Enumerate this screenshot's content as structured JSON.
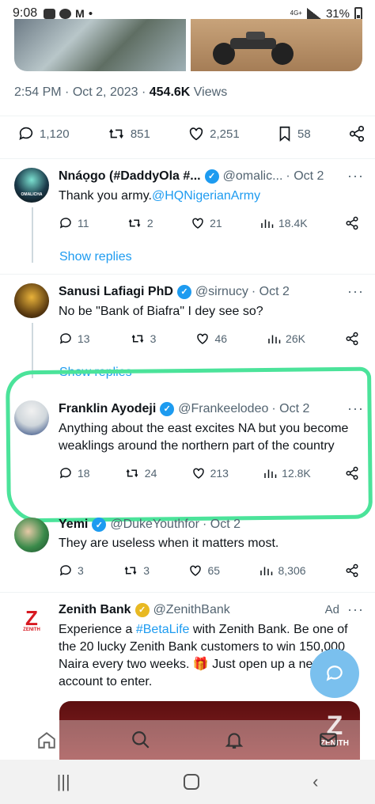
{
  "status_bar": {
    "time": "9:08",
    "network": "4G+",
    "battery": "31%"
  },
  "tweet_meta": {
    "time": "2:54 PM",
    "date": "Oct 2, 2023",
    "views_count": "454.6K",
    "views_label": "Views"
  },
  "tweet_stats": {
    "replies": "1,120",
    "reposts": "851",
    "likes": "2,251",
    "bookmarks": "58"
  },
  "show_replies_label": "Show replies",
  "replies": [
    {
      "name": "Nnáọgo (#DaddyOla #...",
      "handle": "@omalic...",
      "date": "Oct 2",
      "text_before": "Thank you army.",
      "mention": "@HQNigerianArmy",
      "text_after": "",
      "replies": "11",
      "reposts": "2",
      "likes": "21",
      "views": "18.4K",
      "avatar_label": "OMALICHA"
    },
    {
      "name": "Sanusi Lafiagi PhD",
      "handle": "@sirnucy",
      "date": "Oct 2",
      "text_before": "No be \"Bank of Biafra\" I dey see so?",
      "mention": "",
      "text_after": "",
      "replies": "13",
      "reposts": "3",
      "likes": "46",
      "views": "26K"
    },
    {
      "name": "Franklin Ayodeji",
      "handle": "@Frankeelodeo",
      "date": "Oct 2",
      "text_before": "Anything about the east excites NA but you become weaklings around the northern part of the country",
      "mention": "",
      "text_after": "",
      "replies": "18",
      "reposts": "24",
      "likes": "213",
      "views": "12.8K"
    },
    {
      "name": "Yemi",
      "handle": "@DukeYouthfor",
      "date": "Oct 2",
      "text_before": "They are useless when it matters most.",
      "mention": "",
      "text_after": "",
      "replies": "3",
      "reposts": "3",
      "likes": "65",
      "views": "8,306"
    }
  ],
  "ad": {
    "name": "Zenith Bank",
    "handle": "@ZenithBank",
    "label": "Ad",
    "text_before": "Experience a ",
    "hashtag": "#BetaLife",
    "text_after": " with Zenith Bank. Be one of the 20 lucky Zenith Bank customers to win 150,000 Naira every two weeks. 🎁 Just open up a new account to enter.",
    "logo_text": "ZENITH"
  },
  "colors": {
    "accent": "#1d9bf0",
    "highlight": "#4be39a",
    "zenith_red": "#d71921"
  }
}
